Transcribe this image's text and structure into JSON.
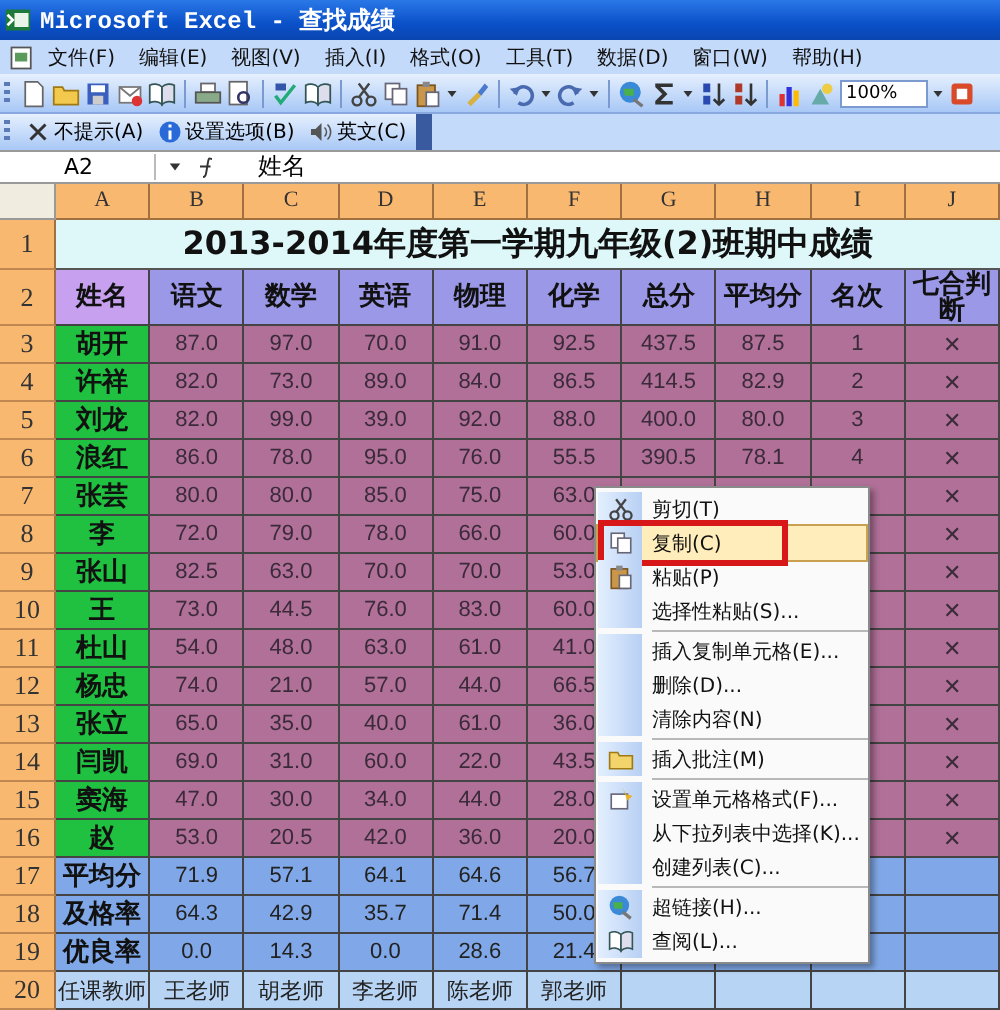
{
  "window": {
    "title": "Microsoft Excel - 查找成绩"
  },
  "menu_bar": [
    "文件(F)",
    "编辑(E)",
    "视图(V)",
    "插入(I)",
    "格式(O)",
    "工具(T)",
    "数据(D)",
    "窗口(W)",
    "帮助(H)"
  ],
  "toolbar": {
    "zoom": "100%"
  },
  "ime_bar": [
    "不提示(A)",
    "设置选项(B)",
    "英文(C)"
  ],
  "formula_bar": {
    "cell": "A2",
    "content": "姓名"
  },
  "sheet": {
    "columns": [
      "A",
      "B",
      "C",
      "D",
      "E",
      "F",
      "G",
      "H",
      "I",
      "J"
    ],
    "title_row": {
      "num": "1",
      "title": "2013-2014年度第一学期九年级(2)班期中成绩"
    },
    "header_row": {
      "num": "2",
      "cells": [
        "姓名",
        "语文",
        "数学",
        "英语",
        "物理",
        "化学",
        "总分",
        "平均分",
        "名次",
        "七合判断"
      ]
    },
    "rows": [
      {
        "num": "3",
        "kind": "student",
        "cells": [
          "胡开",
          "87.0",
          "97.0",
          "70.0",
          "91.0",
          "92.5",
          "437.5",
          "87.5",
          "1"
        ],
        "judge": "✕"
      },
      {
        "num": "4",
        "kind": "student",
        "cells": [
          "许祥",
          "82.0",
          "73.0",
          "89.0",
          "84.0",
          "86.5",
          "414.5",
          "82.9",
          "2"
        ],
        "judge": "✕"
      },
      {
        "num": "5",
        "kind": "student",
        "cells": [
          "刘龙",
          "82.0",
          "99.0",
          "39.0",
          "92.0",
          "88.0",
          "400.0",
          "80.0",
          "3"
        ],
        "judge": "✕"
      },
      {
        "num": "6",
        "kind": "student",
        "cells": [
          "浪红",
          "86.0",
          "78.0",
          "95.0",
          "76.0",
          "55.5",
          "390.5",
          "78.1",
          "4"
        ],
        "judge": "✕"
      },
      {
        "num": "7",
        "kind": "student",
        "cells": [
          "张芸",
          "80.0",
          "80.0",
          "85.0",
          "75.0",
          "63.0"
        ],
        "judge": "✕"
      },
      {
        "num": "8",
        "kind": "student",
        "cells": [
          "李",
          "72.0",
          "79.0",
          "78.0",
          "66.0",
          "60.0"
        ],
        "judge": "✕"
      },
      {
        "num": "9",
        "kind": "student",
        "cells": [
          "张山",
          "82.5",
          "63.0",
          "70.0",
          "70.0",
          "53.0"
        ],
        "judge": "✕"
      },
      {
        "num": "10",
        "kind": "student",
        "cells": [
          "王",
          "73.0",
          "44.5",
          "76.0",
          "83.0",
          "60.0"
        ],
        "judge": "✕"
      },
      {
        "num": "11",
        "kind": "student",
        "cells": [
          "杜山",
          "54.0",
          "48.0",
          "63.0",
          "61.0",
          "41.0"
        ],
        "judge": "✕"
      },
      {
        "num": "12",
        "kind": "student",
        "cells": [
          "杨忠",
          "74.0",
          "21.0",
          "57.0",
          "44.0",
          "66.5"
        ],
        "judge": "✕"
      },
      {
        "num": "13",
        "kind": "student",
        "cells": [
          "张立",
          "65.0",
          "35.0",
          "40.0",
          "61.0",
          "36.0"
        ],
        "judge": "✕"
      },
      {
        "num": "14",
        "kind": "student",
        "cells": [
          "闫凯",
          "69.0",
          "31.0",
          "60.0",
          "22.0",
          "43.5"
        ],
        "judge": "✕"
      },
      {
        "num": "15",
        "kind": "student",
        "cells": [
          "窦海",
          "47.0",
          "30.0",
          "34.0",
          "44.0",
          "28.0"
        ],
        "judge": "✕"
      },
      {
        "num": "16",
        "kind": "student",
        "cells": [
          "赵",
          "53.0",
          "20.5",
          "42.0",
          "36.0",
          "20.0"
        ],
        "judge": "✕"
      },
      {
        "num": "17",
        "kind": "stat",
        "cells": [
          "平均分",
          "71.9",
          "57.1",
          "64.1",
          "64.6",
          "56.7"
        ]
      },
      {
        "num": "18",
        "kind": "stat",
        "cells": [
          "及格率",
          "64.3",
          "42.9",
          "35.7",
          "71.4",
          "50.0"
        ]
      },
      {
        "num": "19",
        "kind": "stat",
        "cells": [
          "优良率",
          "0.0",
          "14.3",
          "0.0",
          "28.6",
          "21.4"
        ]
      },
      {
        "num": "20",
        "kind": "teacher",
        "cells": [
          "任课教师",
          "王老师",
          "胡老师",
          "李老师",
          "陈老师",
          "郭老师"
        ]
      }
    ]
  },
  "context_menu": {
    "items": [
      {
        "kind": "item",
        "label": "剪切(T)",
        "selected": false
      },
      {
        "kind": "item",
        "label": "复制(C)",
        "selected": true
      },
      {
        "kind": "item",
        "label": "粘贴(P)",
        "selected": false
      },
      {
        "kind": "item",
        "label": "选择性粘贴(S)...",
        "selected": false
      },
      {
        "kind": "separator"
      },
      {
        "kind": "item",
        "label": "插入复制单元格(E)...",
        "selected": false
      },
      {
        "kind": "item",
        "label": "删除(D)...",
        "selected": false
      },
      {
        "kind": "item",
        "label": "清除内容(N)",
        "selected": false
      },
      {
        "kind": "separator"
      },
      {
        "kind": "item",
        "label": "插入批注(M)",
        "selected": false
      },
      {
        "kind": "separator"
      },
      {
        "kind": "item",
        "label": "设置单元格格式(F)...",
        "selected": false
      },
      {
        "kind": "item",
        "label": "从下拉列表中选择(K)...",
        "selected": false
      },
      {
        "kind": "item",
        "label": "创建列表(C)...",
        "selected": false
      },
      {
        "kind": "separator"
      },
      {
        "kind": "item",
        "label": "超链接(H)...",
        "selected": false
      },
      {
        "kind": "item",
        "label": "查阅(L)...",
        "selected": false
      }
    ]
  }
}
